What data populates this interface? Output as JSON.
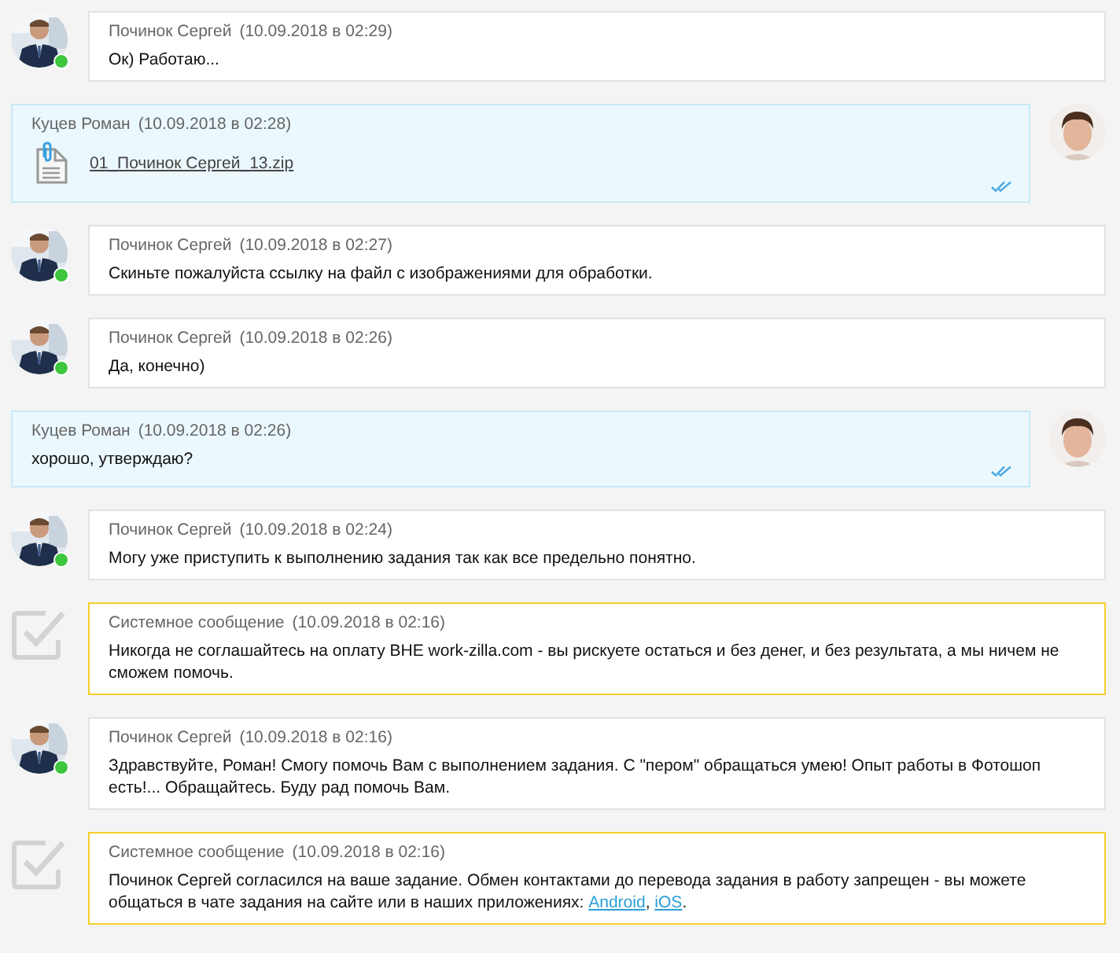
{
  "messages": [
    {
      "kind": "incoming",
      "author": "Починок Сергей",
      "time": "(10.09.2018 в 02:29)",
      "online": true,
      "body": [
        {
          "kind": "text",
          "text": "Ок) Работаю..."
        }
      ]
    },
    {
      "kind": "outgoing",
      "author": "Куцев Роман",
      "time": "(10.09.2018 в 02:28)",
      "read": true,
      "attachment": "01_Починок Сергей_13.zip"
    },
    {
      "kind": "incoming",
      "author": "Починок Сергей",
      "time": "(10.09.2018 в 02:27)",
      "online": true,
      "body": [
        {
          "kind": "text",
          "text": "Скиньте пожалуйста ссылку на файл с изображениями для обработки."
        }
      ]
    },
    {
      "kind": "incoming",
      "author": "Починок Сергей",
      "time": "(10.09.2018 в 02:26)",
      "online": true,
      "body": [
        {
          "kind": "text",
          "text": "Да, конечно)"
        }
      ]
    },
    {
      "kind": "outgoing",
      "author": "Куцев Роман",
      "time": "(10.09.2018 в 02:26)",
      "read": true,
      "body": [
        {
          "kind": "text",
          "text": "хорошо, утверждаю?"
        }
      ]
    },
    {
      "kind": "incoming",
      "author": "Починок Сергей",
      "time": "(10.09.2018 в 02:24)",
      "online": true,
      "body": [
        {
          "kind": "text",
          "text": "Могу уже приступить к выполнению задания так как все предельно понятно."
        }
      ]
    },
    {
      "kind": "system",
      "author": "Системное сообщение",
      "time": "(10.09.2018 в 02:16)",
      "body": [
        {
          "kind": "text",
          "text": "Никогда не соглашайтесь на оплату ВНЕ work-zilla.com - вы рискуете остаться и без денег, и без результата, а мы ничем не сможем помочь."
        }
      ]
    },
    {
      "kind": "incoming",
      "author": "Починок Сергей",
      "time": "(10.09.2018 в 02:16)",
      "online": true,
      "body": [
        {
          "kind": "text",
          "text": "Здравствуйте, Роман! Смогу помочь Вам с выполнением задания. С \"пером\" обращаться умею! Опыт работы в Фотошоп есть!... Обращайтесь. Буду рад помочь Вам."
        }
      ]
    },
    {
      "kind": "system",
      "author": "Системное сообщение",
      "time": "(10.09.2018 в 02:16)",
      "body": [
        {
          "kind": "text",
          "text": "Починок Сергей согласился на ваше задание. Обмен контактами до перевода задания в работу запрещен - вы можете общаться в чате задания на сайте или в наших приложениях: "
        },
        {
          "kind": "link",
          "text": "Android"
        },
        {
          "kind": "text",
          "text": ", "
        },
        {
          "kind": "link",
          "text": "iOS"
        },
        {
          "kind": "text",
          "text": "."
        }
      ]
    }
  ]
}
